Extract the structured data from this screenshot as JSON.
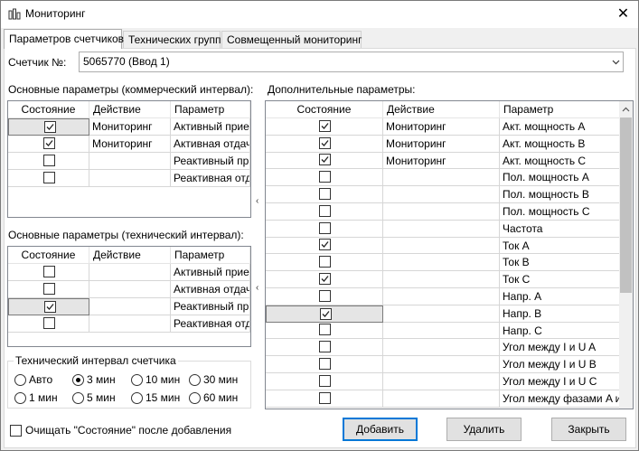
{
  "window": {
    "title": "Мониторинг"
  },
  "tabs": [
    {
      "label": "Параметров счетчиков"
    },
    {
      "label": "Технических групп"
    },
    {
      "label": "Совмещенный мониторинг"
    }
  ],
  "meter": {
    "label": "Счетчик №:",
    "value": "5065770 (Ввод 1)"
  },
  "commercial": {
    "title": "Основные параметры (коммерческий интервал):",
    "columns": [
      "Состояние",
      "Действие",
      "Параметр"
    ],
    "rows": [
      {
        "checked": true,
        "action": "Мониторинг",
        "param": "Активный прием"
      },
      {
        "checked": true,
        "action": "Мониторинг",
        "param": "Активная отдача"
      },
      {
        "checked": false,
        "action": "",
        "param": "Реактивный прием"
      },
      {
        "checked": false,
        "action": "",
        "param": "Реактивная отдача"
      }
    ]
  },
  "technical": {
    "title": "Основные параметры (технический интервал):",
    "columns": [
      "Состояние",
      "Действие",
      "Параметр"
    ],
    "rows": [
      {
        "checked": false,
        "action": "",
        "param": "Активный прием"
      },
      {
        "checked": false,
        "action": "",
        "param": "Активная отдача"
      },
      {
        "checked": true,
        "action": "",
        "param": "Реактивный прием"
      },
      {
        "checked": false,
        "action": "",
        "param": "Реактивная отдача"
      }
    ]
  },
  "interval": {
    "title": "Технический интервал счетчика",
    "options": [
      "Авто",
      "3 мин",
      "10 мин",
      "30 мин",
      "1 мин",
      "5 мин",
      "15 мин",
      "60 мин"
    ],
    "selected": "3 мин"
  },
  "additional": {
    "title": "Дополнительные параметры:",
    "columns": [
      "Состояние",
      "Действие",
      "Параметр"
    ],
    "rows": [
      {
        "checked": true,
        "action": "Мониторинг",
        "param": "Акт. мощность A"
      },
      {
        "checked": true,
        "action": "Мониторинг",
        "param": "Акт. мощность B"
      },
      {
        "checked": true,
        "action": "Мониторинг",
        "param": "Акт. мощность C"
      },
      {
        "checked": false,
        "action": "",
        "param": "Пол. мощность A"
      },
      {
        "checked": false,
        "action": "",
        "param": "Пол. мощность B"
      },
      {
        "checked": false,
        "action": "",
        "param": "Пол. мощность C"
      },
      {
        "checked": false,
        "action": "",
        "param": "Частота"
      },
      {
        "checked": true,
        "action": "",
        "param": "Ток A"
      },
      {
        "checked": false,
        "action": "",
        "param": "Ток B"
      },
      {
        "checked": true,
        "action": "",
        "param": "Ток C"
      },
      {
        "checked": false,
        "action": "",
        "param": "Напр. A"
      },
      {
        "checked": true,
        "action": "",
        "param": "Напр. B"
      },
      {
        "checked": false,
        "action": "",
        "param": "Напр. C"
      },
      {
        "checked": false,
        "action": "",
        "param": "Угол между I и U A"
      },
      {
        "checked": false,
        "action": "",
        "param": "Угол между I и U B"
      },
      {
        "checked": false,
        "action": "",
        "param": "Угол между I и U C"
      },
      {
        "checked": false,
        "action": "",
        "param": "Угол между фазами A и B"
      }
    ]
  },
  "clear_after_add": {
    "label": "Очищать \"Состояние\" после добавления",
    "checked": false
  },
  "buttons": {
    "add": "Добавить",
    "delete": "Удалить",
    "close": "Закрыть"
  }
}
